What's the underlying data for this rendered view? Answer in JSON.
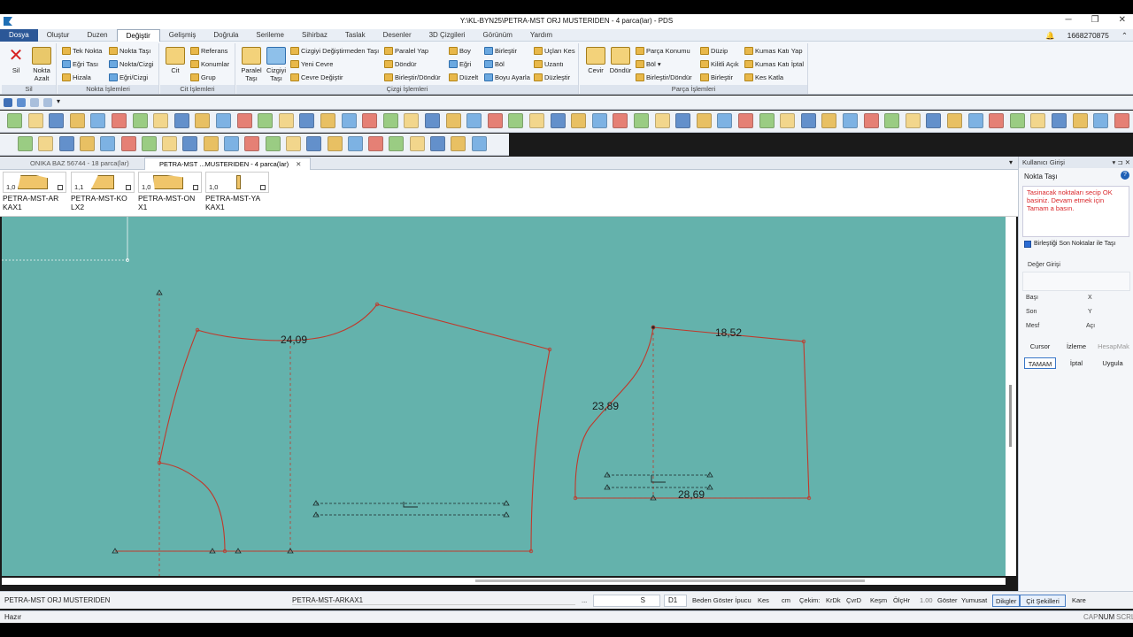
{
  "window": {
    "title": "Y:\\KL-BYN25\\PETRA-MST ORJ MUSTERIDEN  - 4 parca(lar) - PDS",
    "minimize": "─",
    "maximize": "❐",
    "close": "✕"
  },
  "menu": {
    "items": [
      "Dosya",
      "Oluştur",
      "Duzen",
      "Değiştir",
      "Gelişmiş",
      "Doğrula",
      "Serileme",
      "Sihirbaz",
      "Taslak",
      "Desenler",
      "3D Çizgileri",
      "Görünüm",
      "Yardım"
    ],
    "active": "Değiştir",
    "bell": "🔔",
    "user_id": "1668270875",
    "collapse": "⌃"
  },
  "ribbon": {
    "sil": {
      "sil": "Sil",
      "nokta_azalt": "Nokta Azalt",
      "title": "Sil"
    },
    "nokta": {
      "tek_nokta": "Tek Nokta",
      "egri_tasi": "Eğri Tası",
      "hizala": "Hizala",
      "nokta_tasi": "Nokta Taşı",
      "nokta_cizgi": "Nokta/Cizgi",
      "egri_cizgi": "Eğri/Cizgi",
      "title": "Nokta İşlemleri"
    },
    "cit": {
      "cit": "Cit",
      "referans": "Referans",
      "konumlar": "Konumlar",
      "grup": "Grup",
      "title": "Cit İşlemleri"
    },
    "cizgi": {
      "paralel_tasi": "Paralel Taşı",
      "cizgiyi_tasi": "Cizgiyi Taşı",
      "cizgiyi_degistirmeden": "Cizgiyi Değiştirmeden Taşı",
      "yeni_cevre": "Yeni Cevre",
      "cevre_degistir": "Cevre Değiştir",
      "paralel_yap": "Paralel Yap",
      "dondur": "Döndür",
      "birlestir_dondur": "Birleştir/Döndür",
      "boy": "Boy",
      "egri": "Eğri",
      "duzelt": "Düzelt",
      "birlestir": "Birleştir",
      "bol": "Böl",
      "boyu_ayarla": "Boyu Ayarla",
      "uclari_kes": "Uçları Kes",
      "uzanti": "Uzantı",
      "duzlestir": "Düzleştir",
      "title": "Çizgi İşlemleri"
    },
    "parca": {
      "cevir": "Cevir",
      "dondur": "Döndür",
      "parca_konumu": "Parça Konumu",
      "bol": "Böl ▾",
      "birlestir_dondur": "Birleştir/Döndür",
      "duzip": "Düzip",
      "kilitli_acik": "Kilitli Açık",
      "birlestir": "Birleştir",
      "kumas_kati_yap": "Kumas Katı Yap",
      "kumas_kati_iptal": "Kumas Katı İptal",
      "kes_katla": "Kes Katla",
      "title": "Parça İşlemleri"
    }
  },
  "quick_access": {
    "more": "▾"
  },
  "tabs": [
    {
      "label": "ONIKA BAZ 56744  -  18 parca(lar)"
    },
    {
      "label": "PETRA-MST ...MUSTERIDEN  -  4 parca(lar)",
      "close": "✕"
    }
  ],
  "tabs_dropdown": "▾",
  "pieces": [
    {
      "num": "1,0",
      "name_1": "PETRA-MST-AR",
      "name_2": "KAX1"
    },
    {
      "num": "1,1",
      "name_1": "PETRA-MST-KO",
      "name_2": "LX2"
    },
    {
      "num": "1,0",
      "name_1": "PETRA-MST-ON",
      "name_2": "X1"
    },
    {
      "num": "1,0",
      "name_1": "PETRA-MST-YA",
      "name_2": "KAX1"
    }
  ],
  "canvas": {
    "measure_1": "24,09",
    "measure_2": "18,52",
    "measure_3": "23,89",
    "measure_4": "28,69",
    "colors": {
      "background": "#64b2ac",
      "outline": "#c0392b",
      "guide": "#1d2a2a"
    }
  },
  "panel": {
    "title": "Kullanıcı Girişi",
    "controls": "▾ ⊐ ✕",
    "tool": "Nokta Taşı",
    "help": "?",
    "message": "Tasinacak noktaları secip OK basiniz. Devam etmek için Tamam a basın.",
    "checkbox_label": "Birleştiği Son Noktalar ile Taşı",
    "value_input": "Değer Girişi",
    "bas": "Başı",
    "x": "X",
    "son": "Son",
    "y": "Y",
    "mesf": "Mesf",
    "aci": "Açı",
    "cursor": "Cursor",
    "izleme": "İzleme",
    "hesap": "HesapMak",
    "tamam": "TAMAM",
    "iptal": "İptal",
    "uygula": "Uygula"
  },
  "bottombar": {
    "file_name": "PETRA-MST ORJ MUSTERIDEN",
    "piece_name": "PETRA-MST-ARKAX1",
    "dots": "...",
    "size": "S",
    "d1": "D1",
    "beden": "Beden Göster İpucu",
    "kes": "Kes",
    "cm": "cm",
    "cekim": "Çekim:",
    "krdk": "KrDk",
    "cvrd": "ÇvrD",
    "kesm": "Keşm",
    "olchr": "ÖlçHr",
    "scale": "1.00",
    "goster": "Göster",
    "yumusat": "Yumusat",
    "dikgler": "Dikgler",
    "cit_sekilleri": "Çit Şekilleri",
    "kare": "Kare"
  },
  "statusbar": {
    "state": "Hazır",
    "caps": "CAP",
    "num": "NUM",
    "scrl": "SCRL"
  }
}
